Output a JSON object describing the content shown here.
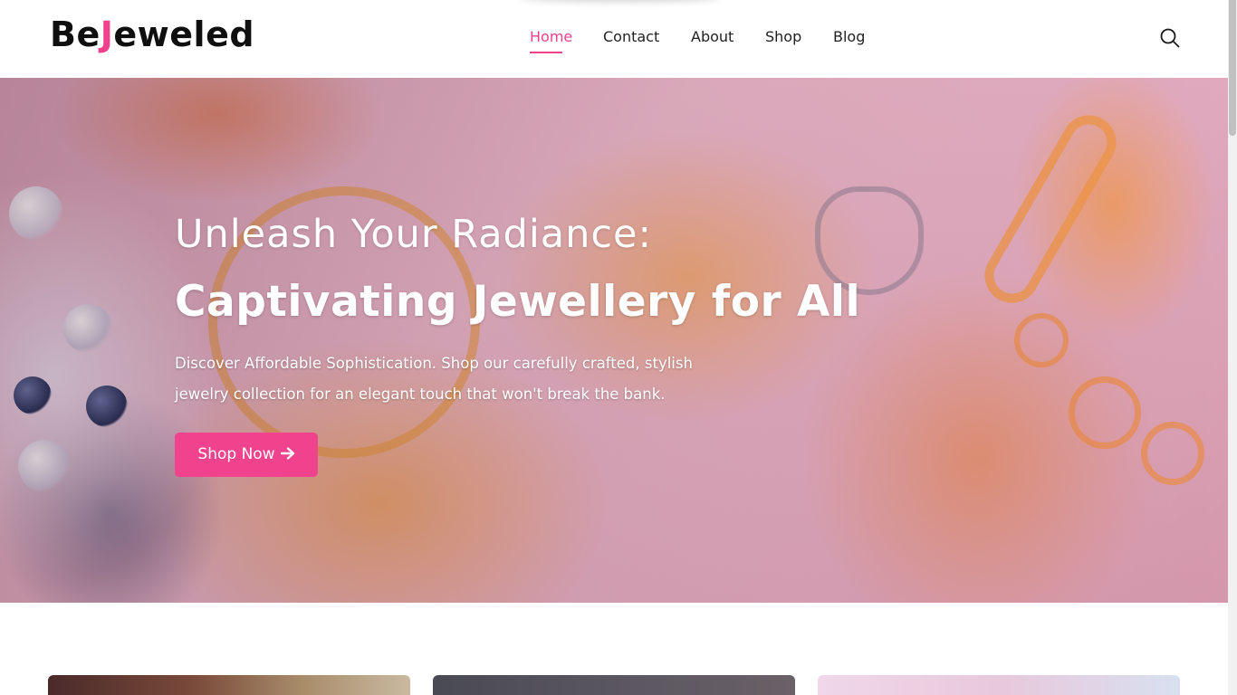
{
  "brand": {
    "logo_prefix": "Be",
    "logo_accent": "J",
    "logo_suffix": "eweled",
    "accent_color": "#f0418c"
  },
  "nav": {
    "items": [
      {
        "label": "Home",
        "active": true
      },
      {
        "label": "Contact",
        "active": false
      },
      {
        "label": "About",
        "active": false
      },
      {
        "label": "Shop",
        "active": false
      },
      {
        "label": "Blog",
        "active": false
      }
    ],
    "search_icon": "search-icon"
  },
  "hero": {
    "subtitle": "Unleash Your Radiance:",
    "title": "Captivating Jewellery for All",
    "description": "Discover Affordable Sophistication. Shop our carefully crafted, stylish jewelry collection for an elegant touch that won't break the bank.",
    "cta_label": "Shop Now",
    "cta_icon": "arrow-right-icon",
    "cta_color": "#f0428d"
  }
}
